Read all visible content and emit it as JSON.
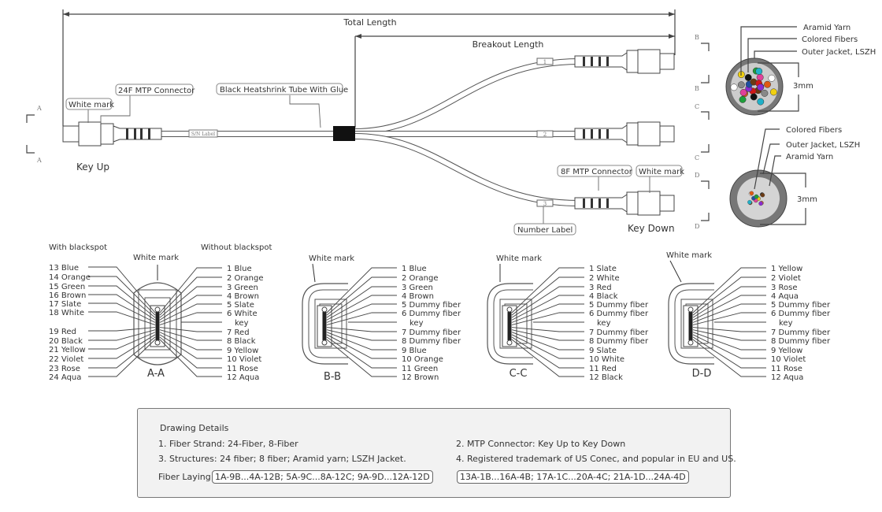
{
  "dimensions": {
    "total_length": "Total Length",
    "breakout_length": "Breakout Length"
  },
  "callouts": {
    "white_mark_left": "White mark",
    "connector_24f": "24F MTP Connector",
    "heatshrink": "Black Heatshrink Tube With Glue",
    "key_up": "Key Up",
    "connector_8f": "8F MTP Connector",
    "white_mark_right": "White mark",
    "number_label": "Number Label",
    "key_down": "Key Down",
    "sn_label": "S/N Label",
    "leg_numbers": [
      "1",
      "2",
      "3"
    ]
  },
  "section_markers": {
    "A": "A",
    "B": "B",
    "C": "C",
    "D": "D"
  },
  "cross_section_24f": {
    "labels": [
      "Aramid Yarn",
      "Colored Fibers",
      "Outer Jacket, LSZH"
    ],
    "diameter": "3mm"
  },
  "cross_section_8f": {
    "labels": [
      "Colored Fibers",
      "Outer Jacket, LSZH",
      "Aramid Yarn"
    ],
    "diameter": "3mm"
  },
  "sections": [
    {
      "title": "A-A",
      "white_mark": "White mark",
      "left_header": "With blackspot",
      "right_header": "Without blackspot",
      "left": [
        "13 Blue",
        "14 Orange",
        "15 Green",
        "16 Brown",
        "17 Slate",
        "18 White",
        "19 Red",
        "20 Black",
        "21 Yellow",
        "22 Violet",
        "23 Rose",
        "24 Aqua"
      ],
      "right": [
        "1 Blue",
        "2 Orange",
        "3 Green",
        "4 Brown",
        "5 Slate",
        "6 White",
        "key",
        "7 Red",
        "8 Black",
        "9 Yellow",
        "10 Violet",
        "11 Rose",
        "12 Aqua"
      ]
    },
    {
      "title": "B-B",
      "white_mark": "White mark",
      "right": [
        "1 Blue",
        "2 Orange",
        "3 Green",
        "4 Brown",
        "5 Dummy fiber",
        "6 Dummy fiber",
        "key",
        "7 Dummy fiber",
        "8 Dummy fiber",
        "9 Blue",
        "10 Orange",
        "11 Green",
        "12 Brown"
      ]
    },
    {
      "title": "C-C",
      "white_mark": "White mark",
      "right": [
        "1 Slate",
        "2 White",
        "3 Red",
        "4 Black",
        "5 Dummy fiber",
        "6 Dummy fiber",
        "key",
        "7 Dummy fiber",
        "8 Dummy fiber",
        "9 Slate",
        "10 White",
        "11 Red",
        "12 Black"
      ]
    },
    {
      "title": "D-D",
      "white_mark": "White mark",
      "right": [
        "1 Yellow",
        "2 Violet",
        "3 Rose",
        "4 Aqua",
        "5 Dummy fiber",
        "6 Dummy fiber",
        "key",
        "7 Dummy fiber",
        "8 Dummy fiber",
        "9 Yellow",
        "10 Violet",
        "11 Rose",
        "12 Aqua"
      ]
    }
  ],
  "details": {
    "title": "Drawing Details",
    "item1": "1. Fiber Strand: 24-Fiber, 8-Fiber",
    "item2": "2. MTP Connector: Key Up to Key Down",
    "item3": "3. Structures: 24 fiber; 8 fiber; Aramid yarn; LSZH Jacket.",
    "item4": "4. Registered trademark of US Conec, and popular in EU and US.",
    "fiber_laying_label": "Fiber Laying:",
    "fiber_laying_1": "1A-9B...4A-12B; 5A-9C...8A-12C; 9A-9D...12A-12D",
    "fiber_laying_2": "13A-1B...16A-4B; 17A-1C...20A-4C; 21A-1D...24A-4D"
  },
  "fiber_colors": [
    "#1f4fa0",
    "#e05a12",
    "#1e9e3a",
    "#6b3a12",
    "#888888",
    "#ffffff",
    "#d01818",
    "#111111",
    "#f0d010",
    "#8a2bd0",
    "#e0409a",
    "#20b0c8"
  ]
}
